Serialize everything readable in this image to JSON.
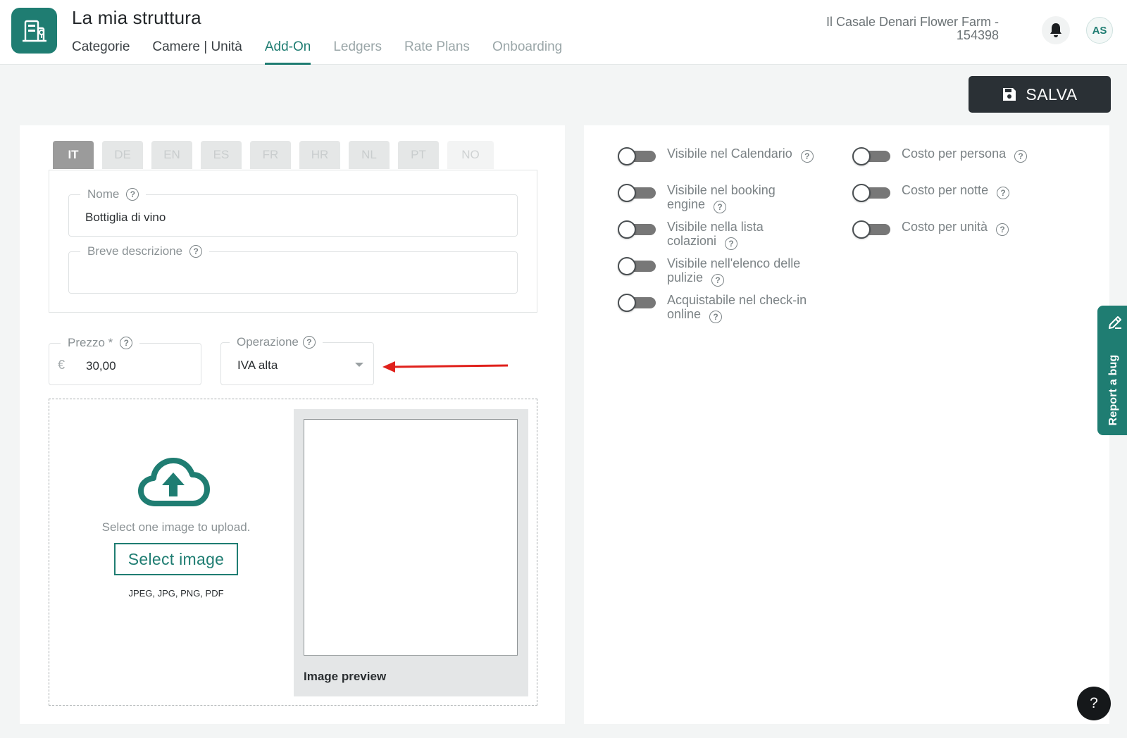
{
  "header": {
    "app_title": "La mia struttura",
    "tabs": [
      {
        "label": "Categorie",
        "state": "default"
      },
      {
        "label": "Camere | Unità",
        "state": "default"
      },
      {
        "label": "Add-On",
        "state": "active"
      },
      {
        "label": "Ledgers",
        "state": "muted"
      },
      {
        "label": "Rate Plans",
        "state": "muted"
      },
      {
        "label": "Onboarding",
        "state": "muted"
      }
    ],
    "property_name": "Il Casale Denari Flower Farm - 154398",
    "user_initials": "AS",
    "icons": {
      "logo": "building-icon",
      "notifications": "bell-icon"
    }
  },
  "toolbar": {
    "save_label": "SALVA",
    "save_icon": "floppy-disk-icon"
  },
  "languages": {
    "tabs": [
      "IT",
      "DE",
      "EN",
      "ES",
      "FR",
      "HR",
      "NL",
      "PT",
      "NO"
    ],
    "active": "IT"
  },
  "form": {
    "name": {
      "label": "Nome",
      "value": "Bottiglia di vino"
    },
    "short_description": {
      "label": "Breve descrizione",
      "value": ""
    },
    "price": {
      "label": "Prezzo *",
      "currency": "€",
      "value": "30,00"
    },
    "operation": {
      "label": "Operazione",
      "value": "IVA alta"
    }
  },
  "upload": {
    "instruction": "Select one image to upload.",
    "button_label": "Select image",
    "file_types": "JPEG, JPG, PNG, PDF",
    "preview_label": "Image preview",
    "icon": "cloud-upload-icon"
  },
  "toggles_left": [
    {
      "label": "Visibile nel Calendario",
      "on": false
    },
    {
      "label": "Visibile nel booking engine",
      "on": false
    },
    {
      "label": "Visibile nella lista colazioni",
      "on": false
    },
    {
      "label": "Visibile nell'elenco delle pulizie",
      "on": false
    },
    {
      "label": "Acquistabile nel check-in online",
      "on": false
    }
  ],
  "toggles_right": [
    {
      "label": "Costo per persona",
      "on": false
    },
    {
      "label": "Costo per notte",
      "on": false
    },
    {
      "label": "Costo per unità",
      "on": false
    }
  ],
  "side_widgets": {
    "report_bug_label": "Report a bug",
    "help_label": "?"
  },
  "colors": {
    "accent": "#1f7d72",
    "dark_button": "#2a3035",
    "annotation_arrow": "#e0201b"
  }
}
